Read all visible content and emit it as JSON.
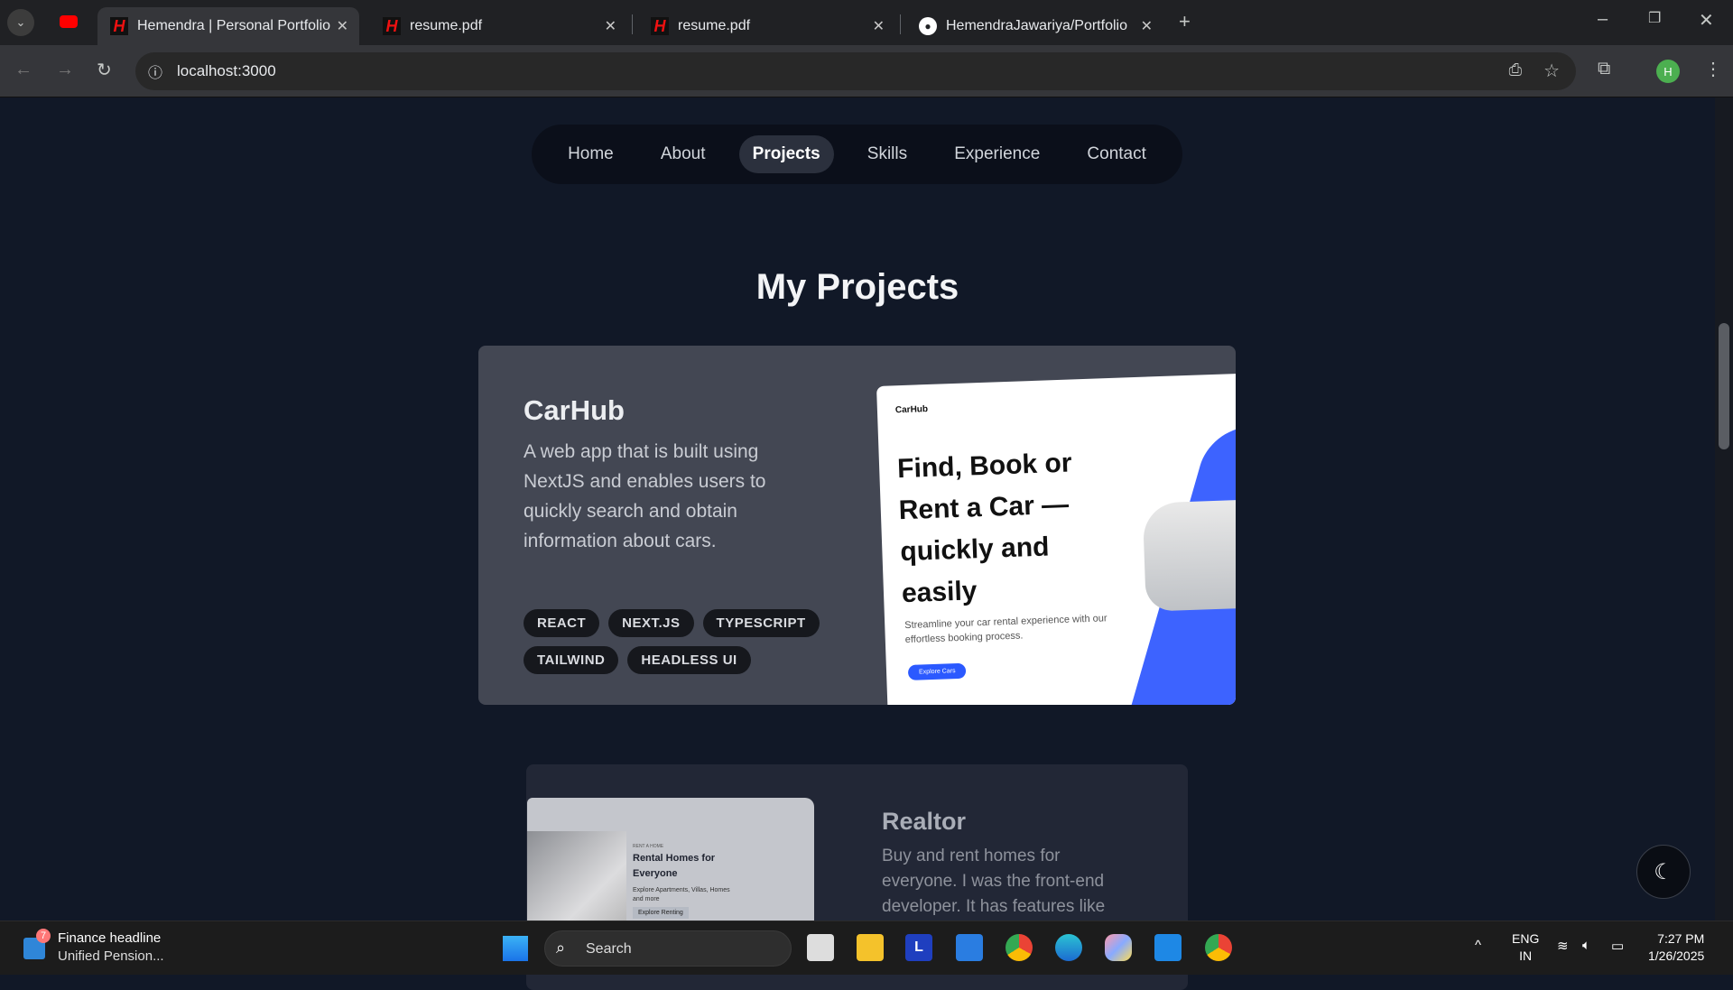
{
  "browser": {
    "tabs": [
      {
        "title": "Hemendra | Personal Portfolio",
        "active": true
      },
      {
        "title": "resume.pdf"
      },
      {
        "title": "resume.pdf"
      },
      {
        "title": "HemendraJawariya/Portfolio"
      }
    ],
    "url": "localhost:3000",
    "profile_initial": "H"
  },
  "nav": {
    "items": [
      "Home",
      "About",
      "Projects",
      "Skills",
      "Experience",
      "Contact"
    ],
    "active": "Projects"
  },
  "section_title": "My Projects",
  "projects": [
    {
      "title": "CarHub",
      "description": "A web app that is built using NextJS and enables users to quickly search and obtain information about cars.",
      "tags": [
        "REACT",
        "NEXT.JS",
        "TYPESCRIPT",
        "TAILWIND",
        "HEADLESS UI"
      ],
      "preview": {
        "logo": "CarHub",
        "headline": "Find, Book or Rent a Car — quickly and easily",
        "subtext": "Streamline your car rental experience with our effortless booking process.",
        "button": "Explore Cars"
      }
    },
    {
      "title": "Realtor",
      "description": "Buy and rent homes for everyone. I was the front-end developer. It has features like",
      "preview": {
        "kicker": "RENT A HOME",
        "headline": "Rental Homes for Everyone",
        "subtext": "Explore Apartments, Villas, Homes and more",
        "button": "Explore Renting"
      }
    }
  ],
  "theme_toggle": {
    "icon": "moon-icon"
  },
  "taskbar": {
    "news_badge": "7",
    "news_title": "Finance headline",
    "news_sub": "Unified Pension...",
    "search": "Search",
    "lang": "ENG",
    "region": "IN",
    "time": "7:27 PM",
    "date": "1/26/2025"
  },
  "colors": {
    "page_bg": "#111827",
    "card1_bg": "#434753",
    "card2_bg": "#222736",
    "accent": "#3d63ff"
  }
}
